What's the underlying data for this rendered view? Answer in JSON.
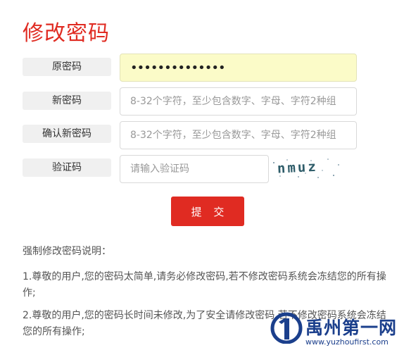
{
  "page": {
    "title": "修改密码"
  },
  "form": {
    "old_password": {
      "label": "原密码",
      "value": "••••••••••••••"
    },
    "new_password": {
      "label": "新密码",
      "placeholder": "8-32个字符，至少包含数字、字母、字符2种组"
    },
    "confirm_password": {
      "label": "确认新密码",
      "placeholder": "8-32个字符，至少包含数字、字母、字符2种组"
    },
    "captcha": {
      "label": "验证码",
      "placeholder": "请输入验证码",
      "image_text": "nmuz"
    },
    "submit_label": "提 交"
  },
  "notes": {
    "heading": "强制修改密码说明：",
    "items": [
      "1.尊敬的用户,您的密码太简单,请务必修改密码,若不修改密码系统会冻结您的所有操作;",
      "2.尊敬的用户,您的密码长时间未修改,为了安全请修改密码,若不修改密码系统会冻结您的所有操作;"
    ]
  },
  "watermark": {
    "name": "禹州第一网",
    "url": "www.yuzhoufirst.com"
  },
  "colors": {
    "accent": "#e02b22",
    "watermark": "#1b3f8c",
    "filled_input": "#fbfbc8"
  }
}
